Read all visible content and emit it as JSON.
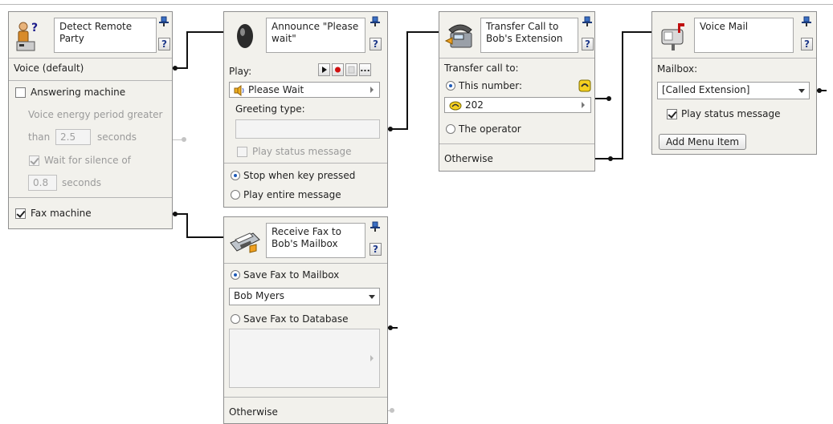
{
  "colors": {
    "node_bg": "#f2f1ec",
    "wire": "#111111",
    "wire_disabled": "#c4c4c4",
    "radio_dot": "#1f5ab7",
    "record_red": "#d01010"
  },
  "detect": {
    "title": "Detect Remote Party",
    "help": "?",
    "voice_label": "Voice (default)",
    "answering_label": "Answering machine",
    "energy_line1": "Voice energy period greater",
    "than": "than",
    "energy_value": "2.5",
    "seconds1": "seconds",
    "wait_label": "Wait for silence of",
    "silence_value": "0.8",
    "seconds2": "seconds",
    "fax_label": "Fax machine"
  },
  "announce": {
    "title": "Announce \"Please wait\"",
    "help": "?",
    "play_label": "Play:",
    "play_value": "Please Wait",
    "more": "...",
    "greeting_label": "Greeting type:",
    "greeting_value": "",
    "status_label": "Play status message",
    "stop_label": "Stop when key pressed",
    "entire_label": "Play entire message"
  },
  "transfer": {
    "title": "Transfer Call to Bob's Extension",
    "help": "?",
    "transfer_label": "Transfer call to:",
    "this_number": "This number:",
    "number_value": "202",
    "operator": "The operator",
    "otherwise": "Otherwise"
  },
  "voicemail": {
    "title": "Voice Mail",
    "help": "?",
    "mailbox_label": "Mailbox:",
    "mailbox_value": "[Called Extension]",
    "play_status": "Play status message",
    "add_item": "Add Menu Item"
  },
  "fax": {
    "title": "Receive Fax to Bob's Mailbox",
    "help": "?",
    "save_mailbox": "Save Fax to Mailbox",
    "mailbox_value": "Bob Myers",
    "save_database": "Save Fax to Database",
    "database_value": "",
    "otherwise": "Otherwise"
  }
}
